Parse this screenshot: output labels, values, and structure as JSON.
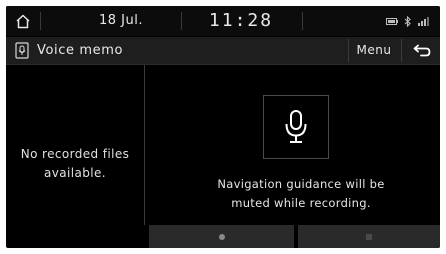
{
  "status_bar": {
    "date": "18 Jul.",
    "time": "11:28",
    "home_icon": "home-icon",
    "icons": [
      "battery-icon",
      "bluetooth-icon",
      "signal-icon"
    ]
  },
  "title_bar": {
    "title": "Voice memo",
    "app_icon": "voice-memo-app-icon",
    "menu_label": "Menu",
    "back_icon": "back-arrow-icon"
  },
  "recordings": {
    "empty_message_line1": "No recorded files",
    "empty_message_line2": "available."
  },
  "recorder": {
    "mic_icon": "microphone-icon",
    "notice_line1": "Navigation guidance will be",
    "notice_line2": "muted while recording.",
    "record_icon": "record-icon",
    "stop_icon": "stop-icon"
  },
  "colors": {
    "background": "#000000",
    "panel": "#1e1e1e",
    "text": "#e8e8e8",
    "button": "#2a2a2a"
  }
}
